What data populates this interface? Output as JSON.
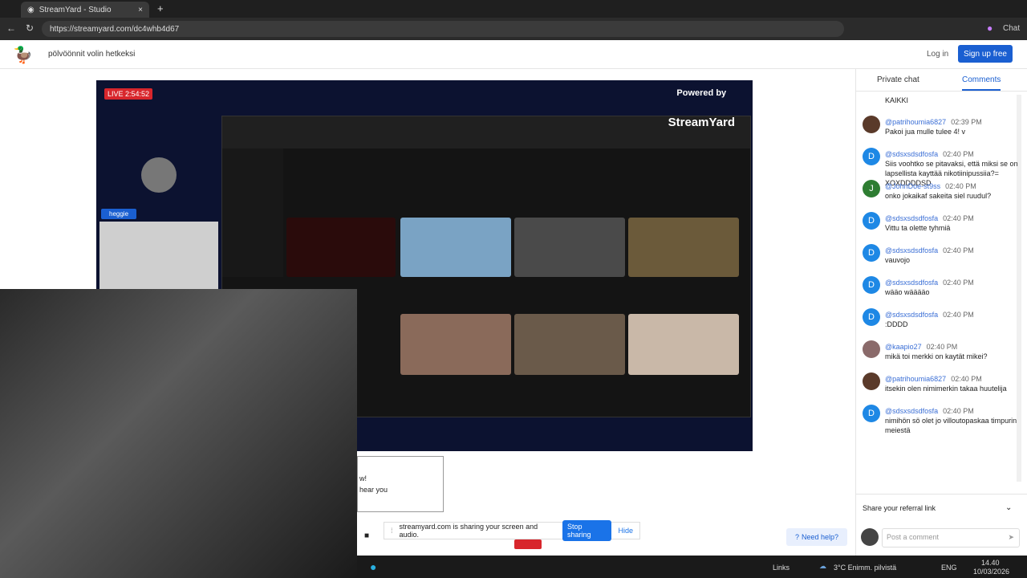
{
  "browser": {
    "tab_title": "StreamYard - Studio",
    "url": "https://streamyard.com/dc4whb4d67",
    "chat_label": "Chat"
  },
  "site": {
    "header_text": "pölvöönnit volin hetkeksi",
    "login": "Log in",
    "signup": "Sign up free"
  },
  "stage": {
    "live_badge": "LIVE 2:54:52",
    "powered_by": "Powered by",
    "brand": "StreamYard",
    "guest_name": "heggie"
  },
  "chat": {
    "tabs": [
      "Private chat",
      "Comments"
    ],
    "first_text": "KAIKKI",
    "messages": [
      {
        "name": "@patrihoumia6827",
        "time": "02:39 PM",
        "text": "Pakoi jua mulle tulee 4! v",
        "initial": "",
        "color": "#5a3a2a"
      },
      {
        "name": "@sdsxsdsdfosfa",
        "time": "02:40 PM",
        "text": "Siis voohtko se pitavaksi, että miksi se on lapsellista kayttää nikotiinipussiia?= XOXDDDDSD",
        "initial": "D",
        "color": "#1e88e5"
      },
      {
        "name": "@JohnDoe-st9ss",
        "time": "02:40 PM",
        "text": "onko jokaikaf sakeita siel ruudul?",
        "initial": "J",
        "color": "#2e7d32"
      },
      {
        "name": "@sdsxsdsdfosfa",
        "time": "02:40 PM",
        "text": "Vittu ta olette tyhmiä",
        "initial": "D",
        "color": "#1e88e5"
      },
      {
        "name": "@sdsxsdsdfosfa",
        "time": "02:40 PM",
        "text": "vauvojo",
        "initial": "D",
        "color": "#1e88e5"
      },
      {
        "name": "@sdsxsdsdfosfa",
        "time": "02:40 PM",
        "text": "wääo wääääo",
        "initial": "D",
        "color": "#1e88e5"
      },
      {
        "name": "@sdsxsdsdfosfa",
        "time": "02:40 PM",
        "text": ":DDDD",
        "initial": "D",
        "color": "#1e88e5"
      },
      {
        "name": "@kaapio27",
        "time": "02:40 PM",
        "text": "mikä toi merkki on kaytät mikei?",
        "initial": "",
        "color": "#8a6a6a"
      },
      {
        "name": "@patrihoumia6827",
        "time": "02:40 PM",
        "text": "itsekin olen nimimerkin takaa huutelija",
        "initial": "",
        "color": "#5a3a2a"
      },
      {
        "name": "@sdsxsdsdfosfa",
        "time": "02:40 PM",
        "text": "nimihön sö olet jo villoutopaskaa timpurin meiestä",
        "initial": "D",
        "color": "#1e88e5"
      }
    ],
    "referral": "Share your referral link",
    "comment_placeholder": "Post a comment"
  },
  "overlay": {
    "popup_line1": "w!",
    "popup_line2": "hear you",
    "share_text": "streamyard.com is sharing your screen and audio.",
    "stop_sharing": "Stop sharing",
    "hide": "Hide",
    "need_help": "Need help?"
  },
  "taskbar": {
    "links": "Links",
    "weather": "3°C  Enimm. pilvistä",
    "lang": "ENG",
    "time": "14.40",
    "date": "10/03/2026"
  }
}
